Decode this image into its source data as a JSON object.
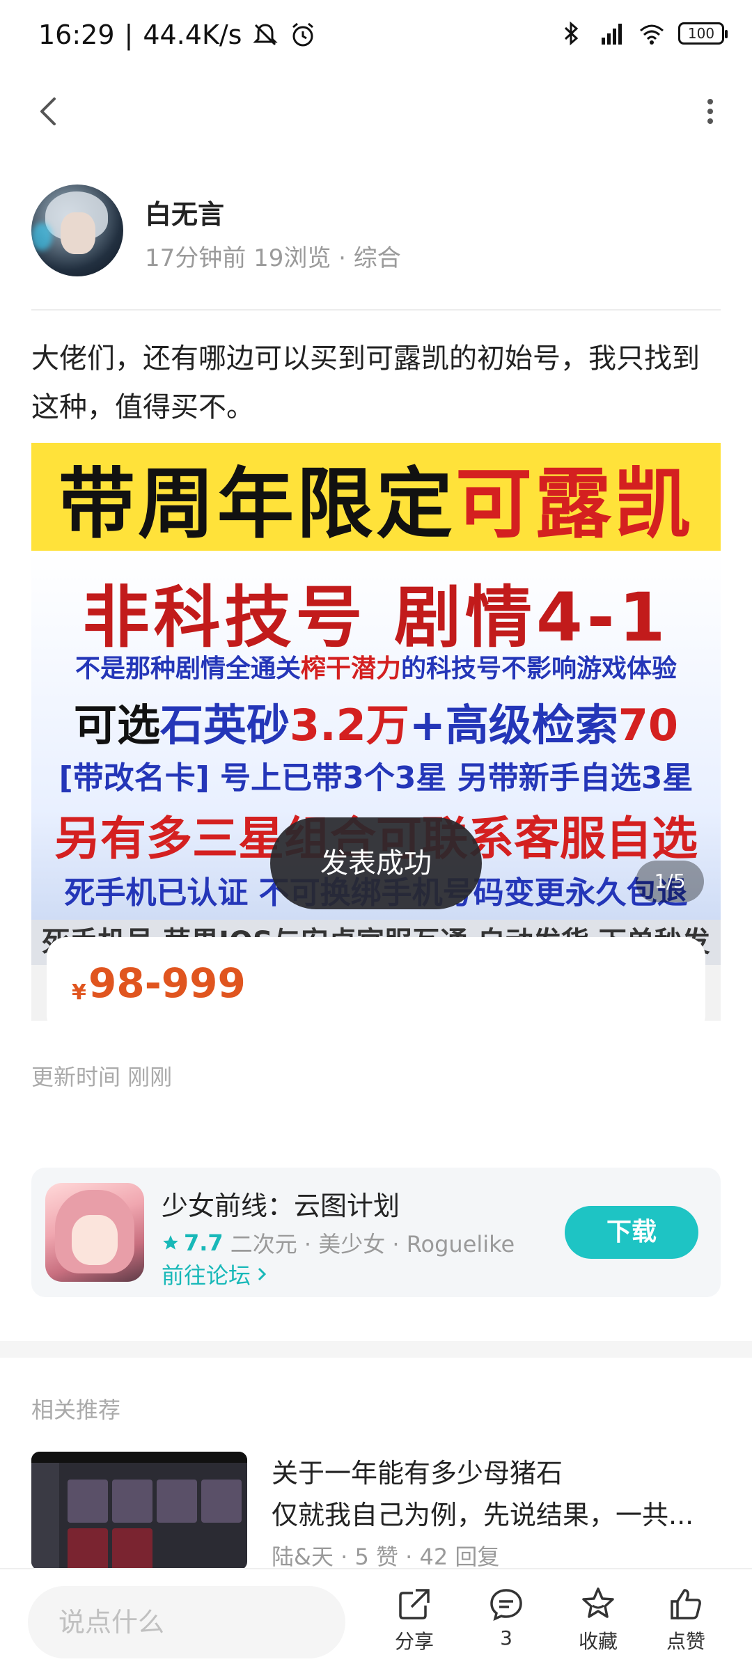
{
  "status_bar": {
    "time": "16:29",
    "net_speed": "44.4K/s",
    "battery": "100"
  },
  "author": {
    "name": "白无言",
    "meta": "17分钟前  19浏览  ·  综合"
  },
  "post": {
    "text": "大佬们，还有哪边可以买到可露凯的初始号，我只找到这种，值得买不。",
    "image": {
      "line_top_black": "带周年限定",
      "line_top_red": "可露凯",
      "line1": "非科技号    剧情4-1",
      "line2_a": "不是那种剧情全通关",
      "line2_b": "榨干潜力",
      "line2_c": "的科技号不影响游戏体验",
      "line3_a": "可选",
      "line3_b": "石英砂",
      "line3_c": "3.2万",
      "line3_d": "+高级检索",
      "line3_e": "70",
      "line4": "[带改名卡] 号上已带3个3星 另带新手自选3星",
      "line5": "另有多三星组合可联系客服自选",
      "line6": "死手机已认证  不可换绑手机号码变更永久包退",
      "line7": "死手机号 苹果IOS与安卓官服互通 自动发货 下单秒发",
      "counter": "1/5",
      "price_currency": "¥",
      "price": "98-999"
    },
    "toast": "发表成功",
    "update_time": "更新时间 刚刚"
  },
  "game_card": {
    "title": "少女前线：云图计划",
    "score": "7.7",
    "tags": "二次元  ·  美少女  ·  Roguelike",
    "forum_link": "前往论坛",
    "download": "下载"
  },
  "related": {
    "title": "相关推荐",
    "item": {
      "line1": "关于一年能有多少母猪石",
      "line2": "仅就我自己为例，先说结果，一共...",
      "meta": "陆&天  ·  5 赞  ·  42 回复"
    }
  },
  "bottom_bar": {
    "placeholder": "说点什么",
    "share": "分享",
    "comments": "3",
    "favorite": "收藏",
    "like": "点赞"
  },
  "colors": {
    "accent": "#1ec4c4",
    "price": "#e0551f"
  }
}
